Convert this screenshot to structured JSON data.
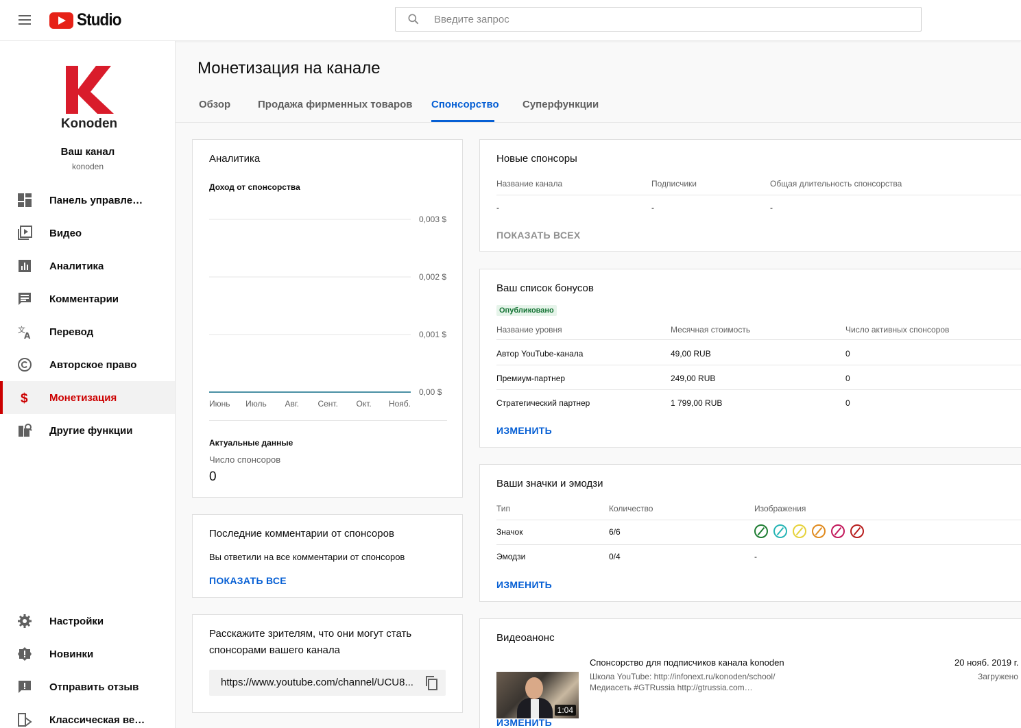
{
  "header": {
    "brand": "Studio",
    "search_placeholder": "Введите запрос"
  },
  "sidebar": {
    "channel_name": "Ваш канал",
    "channel_handle": "konoden",
    "avatar_text": "Konoden",
    "items": [
      {
        "label": "Панель управлен…",
        "icon": "dashboard-icon"
      },
      {
        "label": "Видео",
        "icon": "video-icon"
      },
      {
        "label": "Аналитика",
        "icon": "analytics-icon"
      },
      {
        "label": "Комментарии",
        "icon": "comments-icon"
      },
      {
        "label": "Перевод",
        "icon": "translate-icon"
      },
      {
        "label": "Авторское право",
        "icon": "copyright-icon"
      },
      {
        "label": "Монетизация",
        "icon": "dollar-icon"
      },
      {
        "label": "Другие функции",
        "icon": "other-features-icon"
      }
    ],
    "bottom_items": [
      {
        "label": "Настройки",
        "icon": "gear-icon"
      },
      {
        "label": "Новинки",
        "icon": "whats-new-icon"
      },
      {
        "label": "Отправить отзыв",
        "icon": "feedback-icon"
      },
      {
        "label": "Классическая верси…",
        "icon": "classic-icon"
      }
    ]
  },
  "page": {
    "title": "Монетизация на канале",
    "tabs": [
      "Обзор",
      "Продажа фирменных товаров",
      "Спонсорство",
      "Суперфункции"
    ],
    "active_tab": "Спонсорство"
  },
  "analytics": {
    "title": "Аналитика",
    "chart_title": "Доход от спонсорства",
    "realtime_title": "Актуальные данные",
    "sponsors_label": "Число спонсоров",
    "sponsors_value": "0"
  },
  "chart_data": {
    "type": "line",
    "title": "Доход от спонсорства",
    "categories": [
      "Июнь",
      "Июль",
      "Авг.",
      "Сент.",
      "Окт.",
      "Нояб."
    ],
    "series": [
      {
        "values": [
          0,
          0,
          0,
          0,
          0,
          0
        ]
      }
    ],
    "ylim": [
      0,
      0.003
    ],
    "yticks": [
      "0,003 $",
      "0,002 $",
      "0,001 $",
      "0,00 $"
    ],
    "ytick_values": [
      0.003,
      0.002,
      0.001,
      0
    ],
    "grid": true,
    "line_color": "#4a90a4"
  },
  "comments": {
    "title": "Последние комментарии от спонсоров",
    "text": "Вы ответили на все комментарии от спонсоров",
    "link": "ПОКАЗАТЬ ВСЕ"
  },
  "share": {
    "title_line1": "Расскажите зрителям, что они могут стать",
    "title_line2": "спонсорами вашего канала",
    "url": "https://www.youtube.com/channel/UCU8..."
  },
  "new_sponsors": {
    "title": "Новые спонсоры",
    "columns": [
      "Название канала",
      "Подписчики",
      "Общая длительность спонсорства"
    ],
    "row": [
      "-",
      "-",
      "-"
    ],
    "link": "ПОКАЗАТЬ ВСЕХ"
  },
  "perks": {
    "title": "Ваш список бонусов",
    "status": "Опубликовано",
    "columns": [
      "Название уровня",
      "Месячная стоимость",
      "Число активных спонсоров"
    ],
    "rows": [
      [
        "Автор YouTube-канала",
        "49,00 RUB",
        "0"
      ],
      [
        "Премиум-партнер",
        "249,00 RUB",
        "0"
      ],
      [
        "Стратегический партнер",
        "1 799,00 RUB",
        "0"
      ]
    ],
    "link": "ИЗМЕНИТЬ"
  },
  "badges": {
    "title": "Ваши значки и эмодзи",
    "columns": [
      "Тип",
      "Количество",
      "Изображения"
    ],
    "rows": [
      [
        "Значок",
        "6/6",
        ""
      ],
      [
        "Эмодзи",
        "0/4",
        "-"
      ]
    ],
    "badge_colors": [
      "#1e7d32",
      "#26b5b5",
      "#e6d23a",
      "#e08a1e",
      "#c2185b",
      "#b71c1c"
    ],
    "link": "ИЗМЕНИТЬ"
  },
  "promo": {
    "title": "Видеоанонс",
    "video_title": "Спонсорство для подписчиков канала konoden",
    "desc_line1": "Школа YouTube: http://infonext.ru/konoden/school/",
    "desc_line2": "Медиасеть #GTRussia http://gtrussia.com…",
    "date": "20 нояб. 2019 г.",
    "status": "Загружено",
    "duration": "1:04",
    "link": "ИЗМЕНИТЬ"
  },
  "colors": {
    "accent": "#065fd4",
    "active_nav": "#cc0000",
    "brand_red": "#e62117"
  }
}
